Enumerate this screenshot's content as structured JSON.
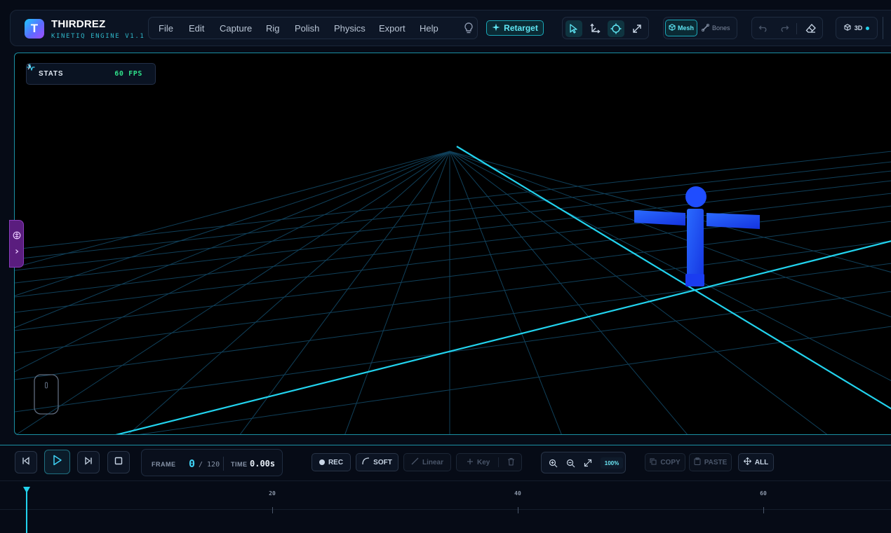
{
  "app": {
    "logo_letter": "T",
    "name": "THIRDREZ",
    "subtitle": "KINETIQ ENGINE V1.1"
  },
  "menu": [
    "File",
    "Edit",
    "Capture",
    "Rig",
    "Polish",
    "Physics",
    "Export",
    "Help"
  ],
  "toolbar": {
    "retarget_label": "Retarget",
    "mesh_label": "Mesh",
    "bones_label": "Bones",
    "view_label": "3D",
    "tools": [
      "select-arrow-icon",
      "axes-icon",
      "rotate-icon",
      "expand-icon"
    ]
  },
  "viewport": {
    "stats_label": "STATS",
    "fps": "60 FPS",
    "accent": "#22d3ee",
    "character_color": "#1f4dff"
  },
  "transport": {
    "frame_label": "FRAME",
    "current_frame": "0",
    "total_frames": "/ 120",
    "time_label": "TIME",
    "time_value": "0.00s",
    "rec_label": "REC",
    "soft_label": "SOFT",
    "linear_label": "Linear",
    "key_label": "Key",
    "zoom_pct": "100%",
    "copy_label": "COPY",
    "paste_label": "PASTE",
    "all_label": "ALL"
  },
  "timeline": {
    "ticks": [
      "20",
      "40",
      "60"
    ],
    "playhead_frame": 0
  }
}
